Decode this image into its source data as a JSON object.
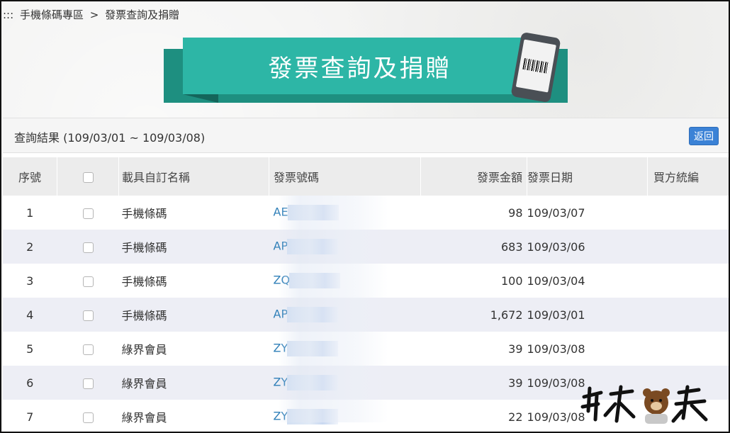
{
  "breadcrumb": {
    "prefix": ":::",
    "section": "手機條碼專區",
    "separator": ">",
    "current": "發票查詢及捐贈"
  },
  "banner": {
    "title": "發票查詢及捐贈",
    "icon": "phone-barcode-icon"
  },
  "result": {
    "caption": "查詢結果 (109/03/01 ~ 109/03/08)",
    "back_label": "返回"
  },
  "table": {
    "headers": {
      "seq": "序號",
      "carrier_name": "載具自訂名稱",
      "invoice_no": "發票號碼",
      "amount": "發票金額",
      "date": "發票日期",
      "buyer_id": "買方統編"
    },
    "rows": [
      {
        "seq": "1",
        "carrier_name": "手機條碼",
        "invoice_no": "AE",
        "amount": "98",
        "date": "109/03/07",
        "buyer_id": ""
      },
      {
        "seq": "2",
        "carrier_name": "手機條碼",
        "invoice_no": "AP",
        "amount": "683",
        "date": "109/03/06",
        "buyer_id": ""
      },
      {
        "seq": "3",
        "carrier_name": "手機條碼",
        "invoice_no": "ZQ",
        "amount": "100",
        "date": "109/03/04",
        "buyer_id": ""
      },
      {
        "seq": "4",
        "carrier_name": "手機條碼",
        "invoice_no": "AP",
        "amount": "1,672",
        "date": "109/03/01",
        "buyer_id": ""
      },
      {
        "seq": "5",
        "carrier_name": "綠界會員",
        "invoice_no": "ZY",
        "amount": "39",
        "date": "109/03/08",
        "buyer_id": ""
      },
      {
        "seq": "6",
        "carrier_name": "綠界會員",
        "invoice_no": "ZY",
        "amount": "39",
        "date": "109/03/08",
        "buyer_id": ""
      },
      {
        "seq": "7",
        "carrier_name": "綠界會員",
        "invoice_no": "ZY",
        "amount": "22",
        "date": "109/03/08",
        "buyer_id": ""
      }
    ]
  },
  "colors": {
    "banner_main": "#2db6a6",
    "banner_dark": "#1e8f80",
    "link": "#2f7fb8",
    "button": "#3b82d6",
    "row_stripe": "#edeef5"
  }
}
